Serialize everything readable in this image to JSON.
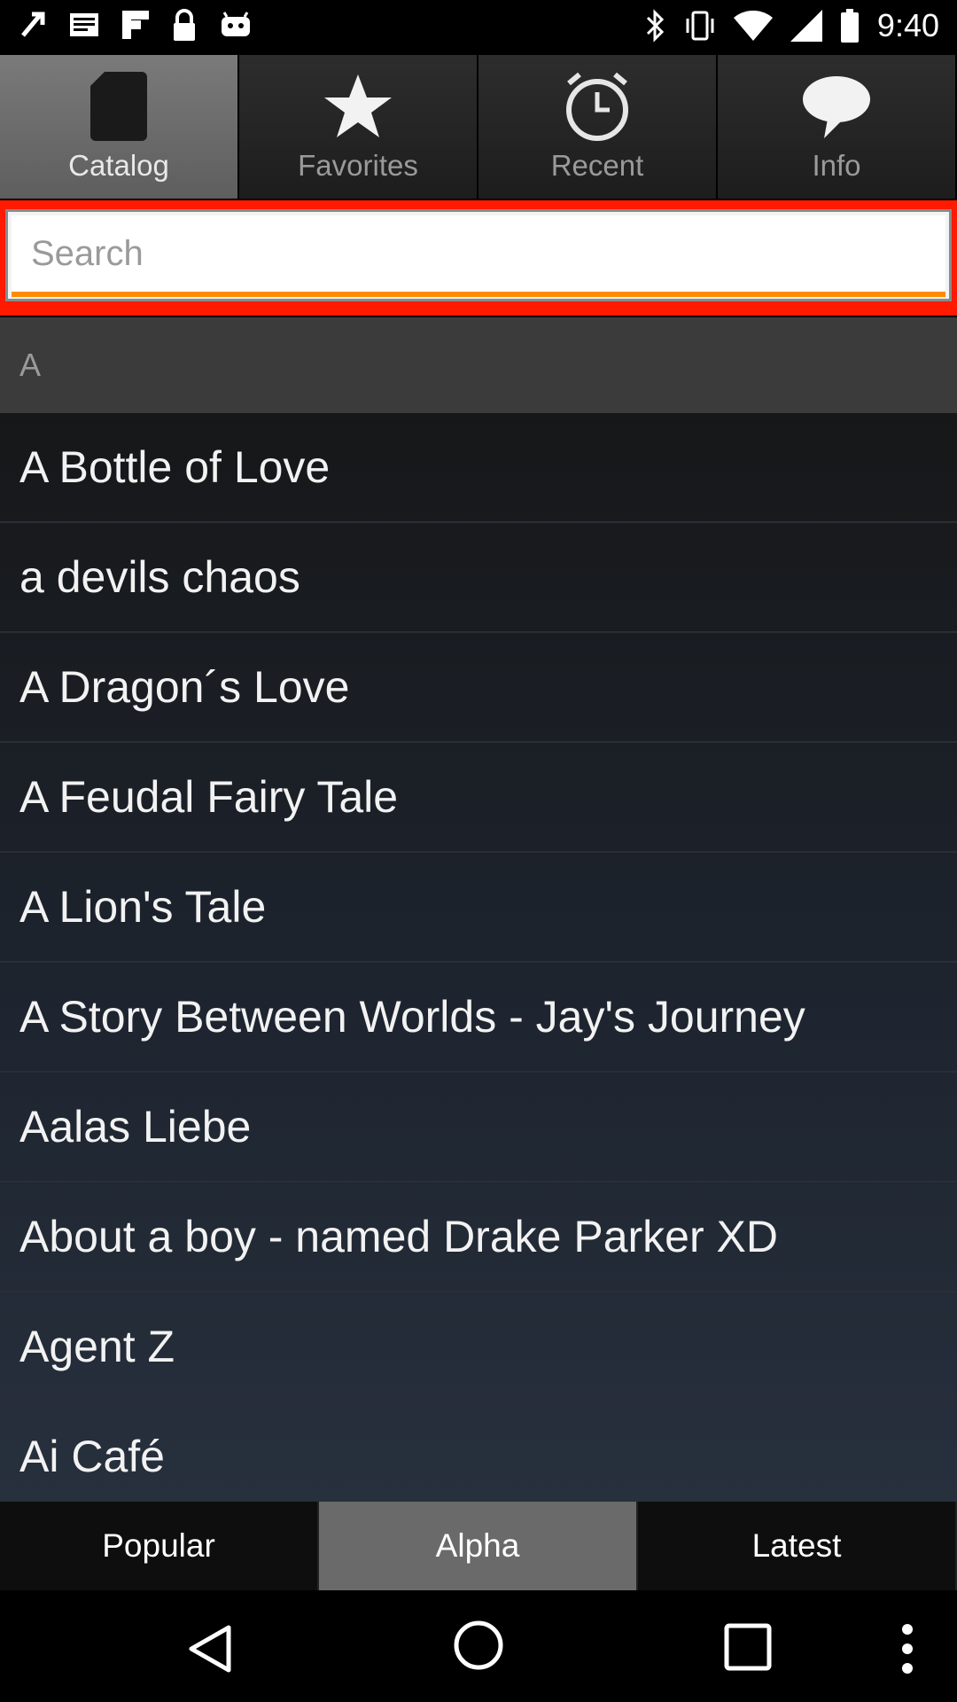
{
  "status_bar": {
    "time": "9:40",
    "left_icons": [
      "notification-icon",
      "mail-icon",
      "flipboard-icon",
      "lock-icon",
      "android-icon"
    ],
    "right_icons": [
      "bluetooth-icon",
      "vibrate-icon",
      "wifi-icon",
      "signal-icon",
      "battery-icon"
    ]
  },
  "tabs": [
    {
      "label": "Catalog",
      "icon": "phone-icon",
      "active": true
    },
    {
      "label": "Favorites",
      "icon": "star-icon",
      "active": false
    },
    {
      "label": "Recent",
      "icon": "clock-icon",
      "active": false
    },
    {
      "label": "Info",
      "icon": "chat-bubble-icon",
      "active": false
    }
  ],
  "search": {
    "placeholder": "Search",
    "value": ""
  },
  "list": {
    "section_header": "A",
    "items": [
      "A Bottle of Love",
      "a devils chaos",
      "A Dragon´s Love",
      "A Feudal Fairy Tale",
      "A Lion's Tale",
      "A Story Between Worlds - Jay's Journey",
      "Aalas Liebe",
      "About a boy - named Drake Parker XD",
      "Agent Z",
      "Ai Café"
    ]
  },
  "bottom_tabs": [
    {
      "label": "Popular",
      "active": false
    },
    {
      "label": "Alpha",
      "active": true
    },
    {
      "label": "Latest",
      "active": false
    }
  ],
  "nav": {
    "buttons": [
      "back-icon",
      "home-icon",
      "recents-icon",
      "overflow-menu-icon"
    ]
  },
  "colors": {
    "search_border": "#ff1a00",
    "search_underline": "#ff8c00",
    "active_tab": "#6a6a6a"
  }
}
